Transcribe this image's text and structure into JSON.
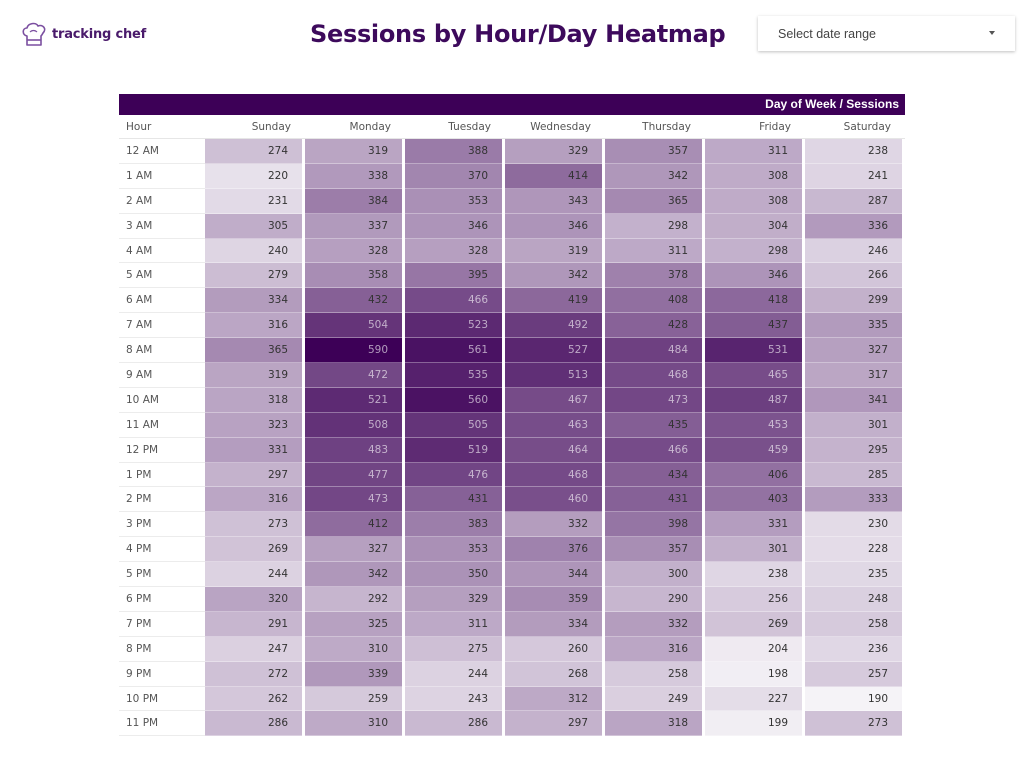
{
  "logo": {
    "text": "tracking chef",
    "icon": "chef-hat-icon"
  },
  "title": "Sessions by Hour/Day Heatmap",
  "date_range": {
    "placeholder": "Select date range",
    "icon": "caret-down-icon"
  },
  "colors": {
    "max": "#3d0057",
    "min": "#f5f3f7",
    "header": "#3d0057",
    "title": "#3d0a5c"
  },
  "chart_data": {
    "type": "heatmap",
    "title": "Sessions by Hour/Day Heatmap",
    "header_label": "Day of Week / Sessions",
    "row_header": "Hour",
    "columns": [
      "Sunday",
      "Monday",
      "Tuesday",
      "Wednesday",
      "Thursday",
      "Friday",
      "Saturday"
    ],
    "rows": [
      "12 AM",
      "1 AM",
      "2 AM",
      "3 AM",
      "4 AM",
      "5 AM",
      "6 AM",
      "7 AM",
      "8 AM",
      "9 AM",
      "10 AM",
      "11 AM",
      "12 PM",
      "1 PM",
      "2 PM",
      "3 PM",
      "4 PM",
      "5 PM",
      "6 PM",
      "7 PM",
      "8 PM",
      "9 PM",
      "10 PM",
      "11 PM"
    ],
    "values": [
      [
        274,
        319,
        388,
        329,
        357,
        311,
        238
      ],
      [
        220,
        338,
        370,
        414,
        342,
        308,
        241
      ],
      [
        231,
        384,
        353,
        343,
        365,
        308,
        287
      ],
      [
        305,
        337,
        346,
        346,
        298,
        304,
        336
      ],
      [
        240,
        328,
        328,
        319,
        311,
        298,
        246
      ],
      [
        279,
        358,
        395,
        342,
        378,
        346,
        266
      ],
      [
        334,
        432,
        466,
        419,
        408,
        418,
        299
      ],
      [
        316,
        504,
        523,
        492,
        428,
        437,
        335
      ],
      [
        365,
        590,
        561,
        527,
        484,
        531,
        327
      ],
      [
        319,
        472,
        535,
        513,
        468,
        465,
        317
      ],
      [
        318,
        521,
        560,
        467,
        473,
        487,
        341
      ],
      [
        323,
        508,
        505,
        463,
        435,
        453,
        301
      ],
      [
        331,
        483,
        519,
        464,
        466,
        459,
        295
      ],
      [
        297,
        477,
        476,
        468,
        434,
        406,
        285
      ],
      [
        316,
        473,
        431,
        460,
        431,
        403,
        333
      ],
      [
        273,
        412,
        383,
        332,
        398,
        331,
        230
      ],
      [
        269,
        327,
        353,
        376,
        357,
        301,
        228
      ],
      [
        244,
        342,
        350,
        344,
        300,
        238,
        235
      ],
      [
        320,
        292,
        329,
        359,
        290,
        256,
        248
      ],
      [
        291,
        325,
        311,
        334,
        332,
        269,
        258
      ],
      [
        247,
        310,
        275,
        260,
        316,
        204,
        236
      ],
      [
        272,
        339,
        244,
        268,
        258,
        198,
        257
      ],
      [
        262,
        259,
        243,
        312,
        249,
        227,
        190
      ],
      [
        286,
        310,
        286,
        297,
        318,
        199,
        273
      ]
    ],
    "value_range": [
      190,
      590
    ]
  }
}
